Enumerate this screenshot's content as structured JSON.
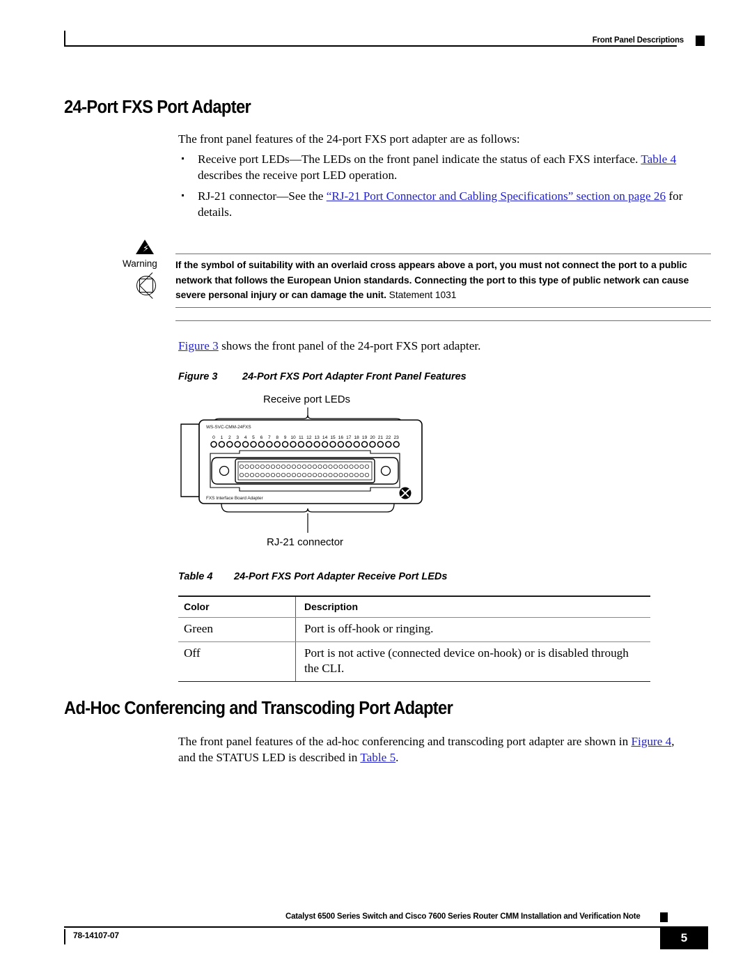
{
  "header": {
    "section_title": "Front Panel Descriptions"
  },
  "sections": {
    "fxs": {
      "heading": "24-Port FXS Port Adapter",
      "intro": "The front panel features of the 24-port FXS port adapter are as follows:",
      "bullets": [
        {
          "text_before": "Receive port LEDs—The LEDs on the front panel indicate the status of each FXS interface. ",
          "link": "Table 4",
          "text_after": " describes the receive port LED operation."
        },
        {
          "text_before": "RJ-21 connector—See the ",
          "link": "“RJ-21 Port Connector and Cabling Specifications” section on page 26",
          "text_after": " for details."
        }
      ]
    },
    "adhoc": {
      "heading": "Ad-Hoc Conferencing and Transcoding Port Adapter",
      "paragraph_before": "The front panel features of the ad-hoc conferencing and transcoding port adapter are shown in ",
      "link_1": "Figure 4",
      "paragraph_middle": ", and the STATUS LED is described in ",
      "link_2": "Table 5",
      "paragraph_after": "."
    }
  },
  "warning": {
    "label": "Warning",
    "body": "If the symbol of suitability with an overlaid cross appears above a port, you must not connect the port to a public network that follows the European Union standards. Connecting the port to this type of public network can cause severe personal injury or can damage the unit.",
    "statement": "Statement 1031",
    "icon_triangle": "warning-triangle-icon",
    "icon_symbol": "crossed-circle-icon"
  },
  "figure": {
    "intro_link": "Figure 3",
    "intro_after": " shows the front panel of the 24-port FXS port adapter.",
    "caption_number": "Figure 3",
    "caption_title": "24-Port FXS Port Adapter Front Panel Features",
    "callout_top": "Receive port LEDs",
    "callout_bottom": "RJ-21 connector",
    "panel_model_label": "WS-SVC-CMM-24FXS",
    "panel_bottom_label": "FXS Interface Board Adapter",
    "artwork_id": "98289",
    "led_numbers": [
      "0",
      "1",
      "2",
      "3",
      "4",
      "5",
      "6",
      "7",
      "8",
      "9",
      "10",
      "11",
      "12",
      "13",
      "14",
      "15",
      "16",
      "17",
      "18",
      "19",
      "20",
      "21",
      "22",
      "23"
    ]
  },
  "table": {
    "caption_number": "Table 4",
    "caption_title": "24-Port FXS Port Adapter Receive Port LEDs",
    "columns": [
      "Color",
      "Description"
    ],
    "rows": [
      [
        "Green",
        "Port is off-hook or ringing."
      ],
      [
        "Off",
        "Port is not active (connected device on-hook) or is disabled through the CLI."
      ]
    ]
  },
  "footer": {
    "doc_title": "Catalyst 6500 Series Switch and Cisco 7600 Series Router CMM Installation and Verification Note",
    "doc_number": "78-14107-07",
    "page_number": "5"
  },
  "colors": {
    "link": "#2222cc",
    "text": "#000000",
    "rule": "#6f6f6f"
  }
}
